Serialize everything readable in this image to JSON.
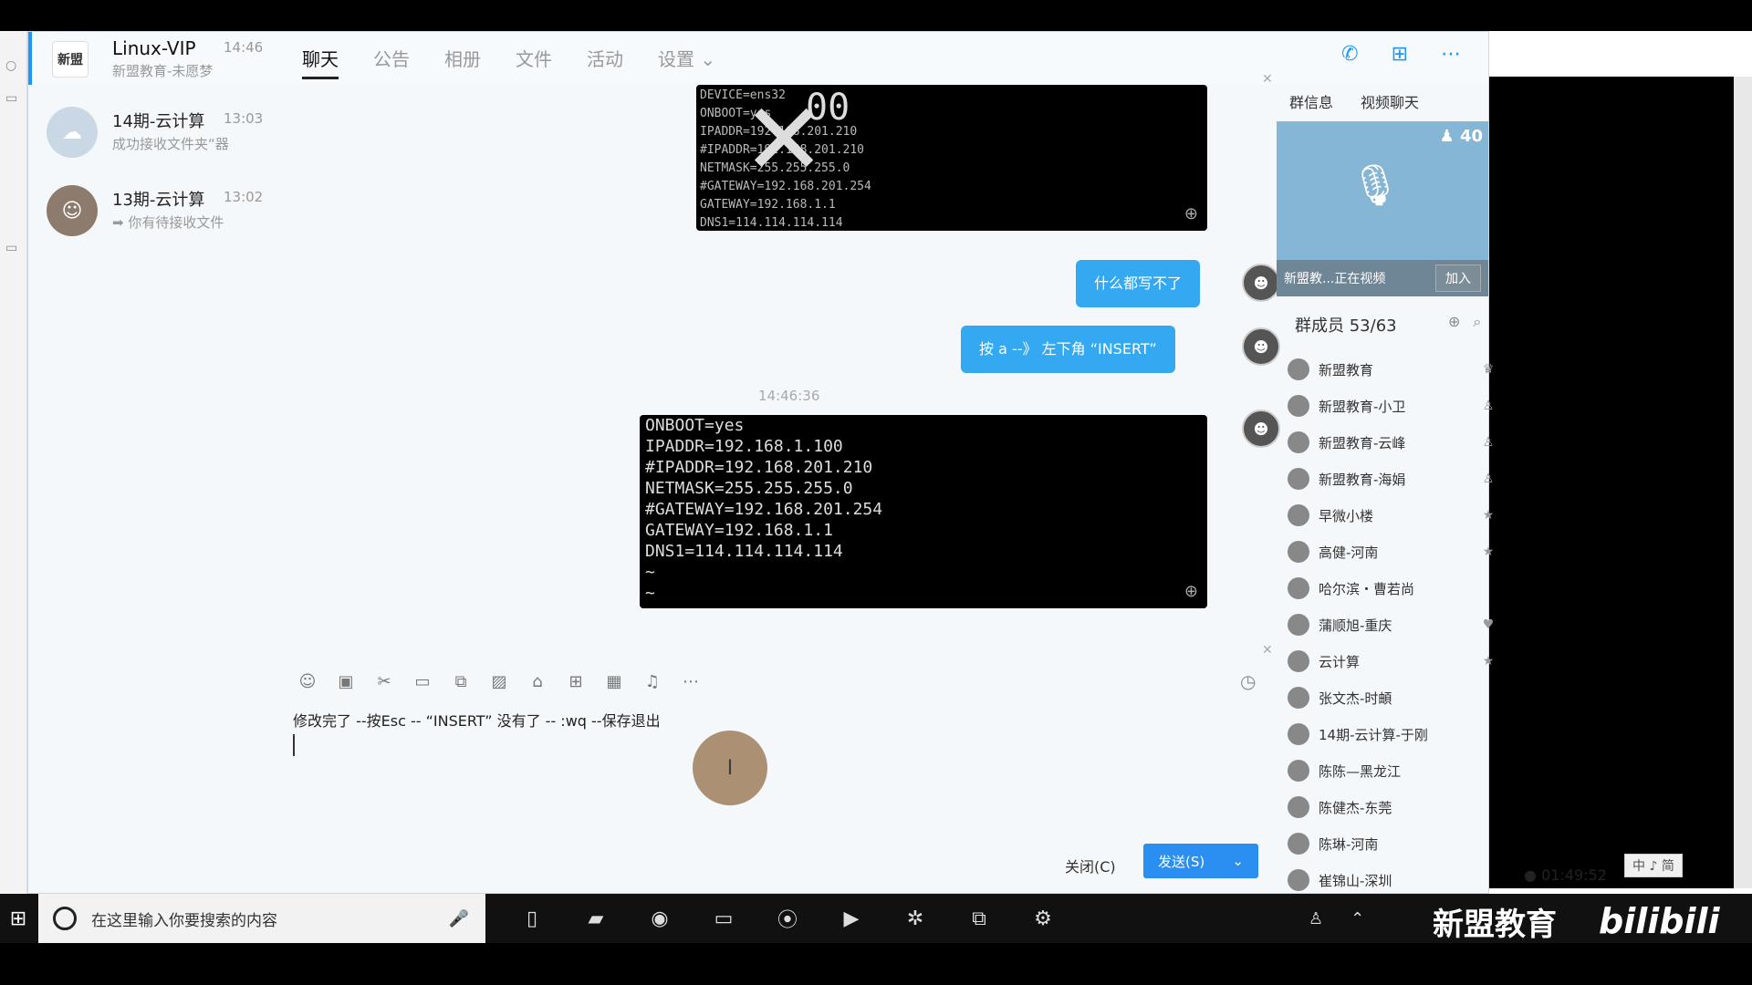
{
  "window": {
    "group_name": "Linux-VIP",
    "group_time": "14:46",
    "group_sub": "新盟教育-未愿梦",
    "group_logo": "新盟"
  },
  "tabs": [
    "聊天",
    "公告",
    "相册",
    "文件",
    "活动",
    "设置"
  ],
  "conversations": [
    {
      "name": "14期-云计算",
      "time": "13:03",
      "sub": "成功接收文件夹“器"
    },
    {
      "name": "13期-云计算",
      "time": "13:02",
      "sub": "➡ 你有待接收文件"
    }
  ],
  "chat": {
    "img1_lines": [
      "DEVICE=ens32",
      "ONBOOT=yes",
      "IPADDR=192.168.201.210",
      "#IPADDR=192.168.201.210",
      "NETMASK=255.255.255.0",
      "#GATEWAY=192.168.201.254",
      "GATEWAY=192.168.1.1",
      "DNS1=114.114.114.114"
    ],
    "img1_mark": "00",
    "bubble1": "什么都写不了",
    "bubble2": "按 a --》 左下角 “INSERT”",
    "timestamp": "14:46:36",
    "img2_lines": [
      "ONBOOT=yes",
      "IPADDR=192.168.1.100",
      "#IPADDR=192.168.201.210",
      "NETMASK=255.255.255.0",
      "#GATEWAY=192.168.201.254",
      "GATEWAY=192.168.1.1",
      "DNS1=114.114.114.114",
      "~",
      "~"
    ]
  },
  "input": {
    "text": "修改完了 --按Esc -- “INSERT” 没有了 -- :wq --保存退出",
    "close_label": "关闭(C)",
    "send_label": "发送(S)"
  },
  "right_panel": {
    "tab_info": "群信息",
    "tab_video": "视频聊天",
    "video_count": "40",
    "video_status": "新盟教...正在视频",
    "join_label": "加入",
    "members_title": "群成员 53/63",
    "members": [
      {
        "name": "新盟教育",
        "badge": "owner"
      },
      {
        "name": "新盟教育-小卫",
        "badge": "admin"
      },
      {
        "name": "新盟教育-云峰",
        "badge": "admin"
      },
      {
        "name": "新盟教育-海娟",
        "badge": "admin"
      },
      {
        "name": "早微小楼",
        "badge": "star"
      },
      {
        "name": "高健-河南",
        "badge": "star"
      },
      {
        "name": "哈尔滨・曹若尚",
        "badge": ""
      },
      {
        "name": "蒲顺旭-重庆",
        "badge": "heart"
      },
      {
        "name": "云计算",
        "badge": "star"
      },
      {
        "name": "张文杰-时頔",
        "badge": ""
      },
      {
        "name": "14期-云计算-于刚",
        "badge": ""
      },
      {
        "name": "陈陈—黑龙江",
        "badge": ""
      },
      {
        "name": "陈健杰-东莞",
        "badge": ""
      },
      {
        "name": "陈琳-河南",
        "badge": ""
      },
      {
        "name": "崔锦山-深圳",
        "badge": ""
      }
    ]
  },
  "taskbar": {
    "search_placeholder": "在这里输入你要搜索的内容",
    "brand": "新盟教育",
    "bilibili": "bilibili",
    "time": "01:49:52",
    "ime": "中 ♪ 简"
  },
  "colors": {
    "accent": "#2196f3",
    "bubble": "#34a8f0",
    "send": "#2a8ff0"
  }
}
